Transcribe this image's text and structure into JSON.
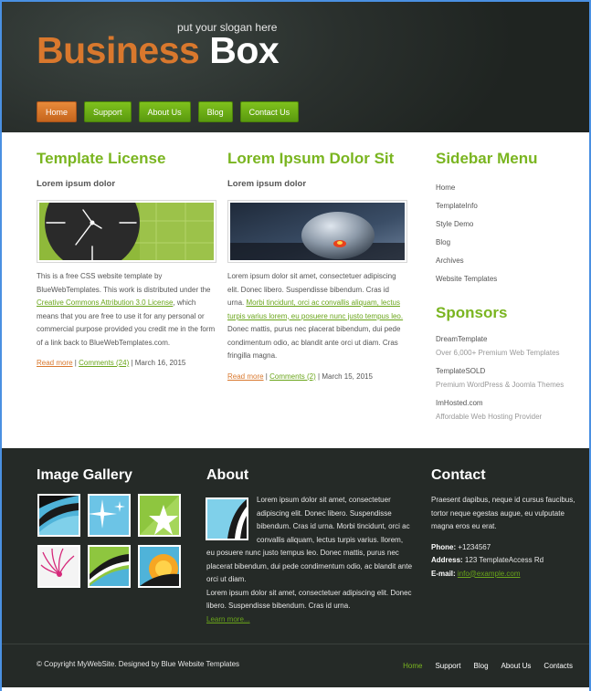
{
  "header": {
    "slogan": "put your slogan here",
    "logo_part1": "Business",
    "logo_part2": "Box",
    "nav": [
      "Home",
      "Support",
      "About Us",
      "Blog",
      "Contact Us"
    ]
  },
  "posts": [
    {
      "title": "Template License",
      "subtitle": "Lorem ipsum dolor",
      "image": "clock-graphic",
      "text_before": "This is a free CSS website template by BlueWebTemplates. This work is distributed under the ",
      "link_text": "Creative Commons Attribution 3.0 License",
      "text_after": ", which means that you are free to use it for any personal or commercial purpose provided you credit me in the form of a link back to BlueWebTemplates.com.",
      "read_more": "Read more",
      "comments": "Comments (24)",
      "date": "March 16, 2015"
    },
    {
      "title": "Lorem Ipsum Dolor Sit",
      "subtitle": "Lorem ipsum dolor",
      "image": "computer-mouse-photo",
      "text_before": "Lorem ipsum dolor sit amet, consectetuer adipiscing elit. Donec libero. Suspendisse bibendum. Cras id urna. ",
      "link_text": "Morbi tincidunt, orci ac convallis aliquam, lectus turpis varius lorem, eu posuere nunc justo tempus leo.",
      "text_after": " Donec mattis, purus nec placerat bibendum, dui pede condimentum odio, ac blandit ante orci ut diam. Cras fringilla magna.",
      "read_more": "Read more",
      "comments": "Comments (2)",
      "date": "March 15, 2015"
    }
  ],
  "sidebar": {
    "title": "Sidebar Menu",
    "items": [
      "Home",
      "TemplateInfo",
      "Style Demo",
      "Blog",
      "Archives",
      "Website Templates"
    ]
  },
  "sponsors": {
    "title": "Sponsors",
    "items": [
      {
        "name": "DreamTemplate",
        "desc": "Over 6,000+ Premium Web Templates"
      },
      {
        "name": "TemplateSOLD",
        "desc": "Premium WordPress & Joomla Themes"
      },
      {
        "name": "ImHosted.com",
        "desc": "Affordable Web Hosting Provider"
      }
    ]
  },
  "gallery": {
    "title": "Image Gallery",
    "thumbs": [
      "wave-thumb",
      "sparkle-thumb",
      "star-thumb",
      "flower-thumb",
      "stripe-thumb",
      "sunrise-thumb"
    ]
  },
  "about": {
    "title": "About",
    "p1": "Lorem ipsum dolor sit amet, consectetuer adipiscing elit. Donec libero. Suspendisse bibendum. Cras id urna. Morbi tincidunt, orci ac convallis aliquam, lectus turpis varius. llorem, eu posuere nunc justo tempus leo. Donec mattis, purus nec placerat bibendum, dui pede condimentum odio, ac blandit ante orci ut diam.",
    "p2": "Lorem ipsum dolor sit amet, consectetuer adipiscing elit. Donec libero. Suspendisse bibendum. Cras id urna.",
    "more": "Learn more..."
  },
  "contact": {
    "title": "Contact",
    "intro": "Praesent dapibus, neque id cursus faucibus, tortor neque egestas augue, eu vulputate magna eros eu erat.",
    "phone_label": "Phone:",
    "phone": "+1234567",
    "address_label": "Address:",
    "address": "123 TemplateAccess Rd",
    "email_label": "E-mail:",
    "email": "info@example.com"
  },
  "footer": {
    "copy": "© Copyright MyWebSite. Designed by Blue ",
    "copy_link": "Website Templates",
    "nav": [
      "Home",
      "Support",
      "Blog",
      "About Us",
      "Contacts"
    ]
  },
  "colors": {
    "accent_green": "#7ab520",
    "accent_orange": "#d9782d",
    "dark_bg": "#252a27"
  }
}
